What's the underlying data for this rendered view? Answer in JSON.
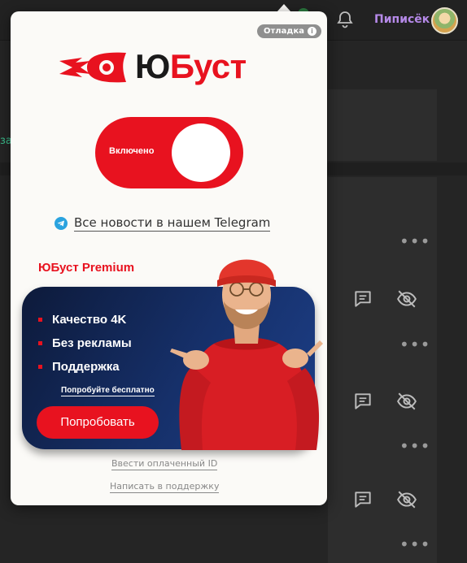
{
  "background": {
    "username": "Пиписёк",
    "left_fragment": "за"
  },
  "popup": {
    "debug_badge": "Отладка",
    "logo": {
      "part1": "Ю",
      "part2": "Буст"
    },
    "toggle": {
      "label": "Включено",
      "state": "on"
    },
    "telegram_link": "Все новости в нашем Telegram",
    "premium": {
      "title": "ЮБуст Premium",
      "features": [
        "Качество 4K",
        "Без рекламы",
        "Поддержка"
      ],
      "try_free": "Попробуйте бесплатно",
      "try_button": "Попробовать"
    },
    "enter_id": "Ввести оплаченный ID",
    "support": "Написать в поддержку"
  },
  "colors": {
    "accent": "#e8121f",
    "card": "#16306a",
    "telegram": "#2aa3df",
    "username": "#b589e8"
  }
}
